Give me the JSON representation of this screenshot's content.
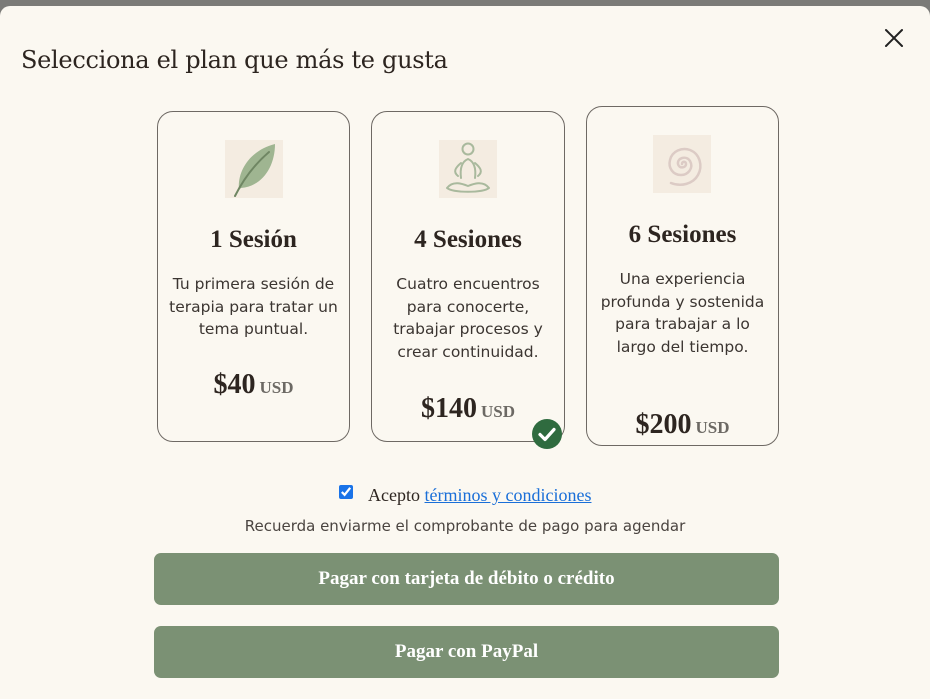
{
  "modal": {
    "title": "Selecciona el plan que más te gusta",
    "close_icon": "close-icon"
  },
  "plans": [
    {
      "icon": "leaf-icon",
      "name": "1 Sesión",
      "description": "Tu primera sesión de terapia para tratar un tema puntual.",
      "price": "$40",
      "currency": "USD",
      "selected": false
    },
    {
      "icon": "meditation-icon",
      "name": "4 Sesiones",
      "description": "Cuatro encuentros para conocerte, trabajar procesos y crear continuidad.",
      "price": "$140",
      "currency": "USD",
      "selected": true
    },
    {
      "icon": "spiral-icon",
      "name": "6 Sesiones",
      "description": "Una experiencia profunda y sostenida para trabajar a lo largo del tiempo.",
      "price": "$200",
      "currency": "USD",
      "selected": false
    }
  ],
  "terms": {
    "checked": true,
    "prefix": "Acepto",
    "link_text": "términos y condiciones"
  },
  "reminder": "Recuerda enviarme el comprobante de pago para agendar",
  "buttons": {
    "card": "Pagar con tarjeta de débito o crédito",
    "paypal": "Pagar con PayPal"
  },
  "colors": {
    "accent": "#7b9174",
    "selected_check": "#2f6b3f",
    "background": "#fbf8f1",
    "link": "#1a6fd8"
  }
}
